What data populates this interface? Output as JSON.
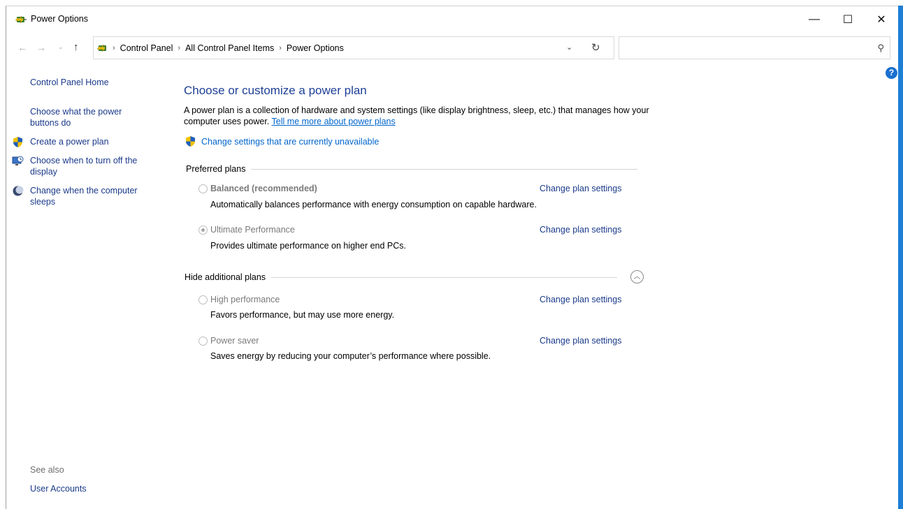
{
  "window": {
    "title": "Power Options",
    "title_icon": "power-options-icon",
    "minimize_glyph": "—",
    "maximize_glyph": "☐",
    "close_glyph": "✕"
  },
  "nav": {
    "back_glyph": "←",
    "forward_glyph": "→",
    "recent_glyph": "⌄",
    "up_glyph": "↑",
    "breadcrumbs": [
      "Control Panel",
      "All Control Panel Items",
      "Power Options"
    ],
    "separator": "›",
    "dropdown_glyph": "⌄",
    "refresh_glyph": "↻",
    "search_placeholder": "",
    "search_glyph": "⚲"
  },
  "help": {
    "label": "?"
  },
  "sidebar": {
    "home": "Control Panel Home",
    "items": [
      {
        "label": "Choose what the power buttons do",
        "icon": ""
      },
      {
        "label": "Create a power plan",
        "icon": "uac-shield-icon"
      },
      {
        "label": "Choose when to turn off the display",
        "icon": "display-icon"
      },
      {
        "label": "Change when the computer sleeps",
        "icon": "moon-icon"
      }
    ],
    "see_also": "See also",
    "user_accounts": "User Accounts"
  },
  "main": {
    "title": "Choose or customize a power plan",
    "desc_text": "A power plan is a collection of hardware and system settings (like display brightness, sleep, etc.) that manages how your computer uses power.",
    "desc_link": "Tell me more about power plans",
    "change_settings": "Change settings that are currently unavailable",
    "preferred_header": "Preferred plans",
    "additional_header": "Hide additional plans",
    "collapse_glyph": "︿",
    "plans": [
      {
        "name": "Balanced (recommended)",
        "desc": "Automatically balances performance with energy consumption on capable hardware.",
        "link": "Change plan settings",
        "selected": false
      },
      {
        "name": "Ultimate Performance",
        "desc": "Provides ultimate performance on higher end PCs.",
        "link": "Change plan settings",
        "selected": true
      },
      {
        "name": "High performance",
        "desc": "Favors performance, but may use more energy.",
        "link": "Change plan settings",
        "selected": false
      },
      {
        "name": "Power saver",
        "desc": "Saves energy by reducing your computer’s performance where possible.",
        "link": "Change plan settings",
        "selected": false
      }
    ]
  },
  "colors": {
    "accent": "#1e7fd6",
    "link": "#0066cc",
    "nav_link": "#1b3a8a",
    "title": "#1e3f96"
  }
}
